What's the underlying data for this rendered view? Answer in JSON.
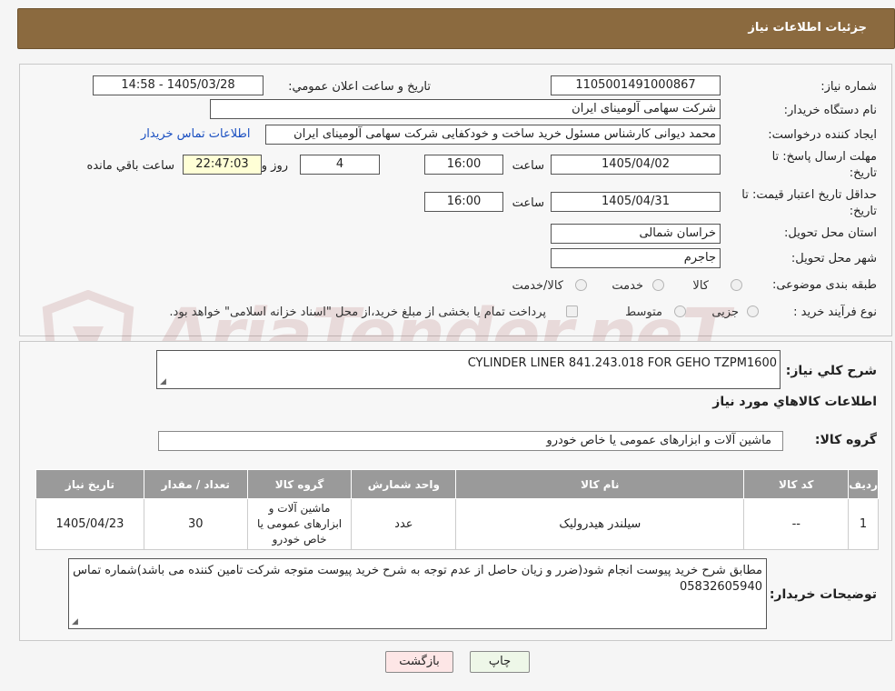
{
  "header": {
    "title": "جزئیات اطلاعات نیاز"
  },
  "form": {
    "need_number_label": "شماره نیاز:",
    "need_number": "1105001491000867",
    "announce_label": "تاریخ و ساعت اعلان عمومي:",
    "announce_value": "1405/03/28 - 14:58",
    "buyer_org_label": "نام دستگاه خریدار:",
    "buyer_org": "شرکت سهامی آلومینای ایران",
    "creator_label": "ایجاد کننده درخواست:",
    "creator": "محمد دیوانی کارشناس مسئول خرید ساخت و خودکفایی شرکت سهامی آلومینای ایران",
    "contact_link": "اطلاعات تماس خریدار",
    "reply_deadline_label": "مهلت ارسال پاسخ: تا",
    "reply_deadline_label2": "تاریخ:",
    "reply_date": "1405/04/02",
    "time_label": "ساعت",
    "reply_time": "16:00",
    "days_value": "4",
    "days_label": "روز و",
    "remaining_time": "22:47:03",
    "remaining_label": "ساعت باقي مانده",
    "price_validity_label": "حداقل تاریخ اعتبار قیمت: تا",
    "price_validity_label2": "تاریخ:",
    "price_date": "1405/04/31",
    "price_time": "16:00",
    "province_label": "استان محل تحویل:",
    "province": "خراسان شمالی",
    "city_label": "شهر محل تحویل:",
    "city": "جاجرم",
    "category_label": "طبقه بندی موضوعی:",
    "category_options": [
      "کالا",
      "خدمت",
      "کالا/خدمت"
    ],
    "process_label": "نوع فرآیند خرید :",
    "process_options": [
      "جزیی",
      "متوسط"
    ],
    "payment_note": "پرداخت تمام یا بخشی از مبلغ خرید،از محل \"اسناد خزانه اسلامی\" خواهد بود."
  },
  "watermark": "AriaTender.neT",
  "description": {
    "label": "شرح کلي نياز:",
    "value": "CYLINDER LINER 841.243.018 FOR GEHO TZPM1600"
  },
  "goods_section_title": "اطلاعات کالاهاي مورد نياز",
  "goods_group": {
    "label": "گروه کالا:",
    "value": "ماشین آلات و ابزارهای عمومی یا خاص خودرو"
  },
  "table": {
    "headers": [
      "رديف",
      "کد کالا",
      "نام کالا",
      "واحد شمارش",
      "گروه کالا",
      "تعداد / مقدار",
      "تاریخ نیاز"
    ],
    "rows": [
      {
        "row": "1",
        "code": "--",
        "name": "سیلندر هیدرولیک",
        "unit": "عدد",
        "group": "ماشین آلات و ابزارهای عمومی یا خاص خودرو",
        "qty": "30",
        "date": "1405/04/23"
      }
    ]
  },
  "buyer_notes": {
    "label": "توضیحات خریدار:",
    "value": "مطابق شرح خرید پیوست انجام شود(ضرر و زیان حاصل از عدم توجه به شرح خرید پیوست متوجه شرکت تامین کننده می باشد)شماره تماس 05832605940"
  },
  "buttons": {
    "print": "چاپ",
    "back": "بازگشت"
  }
}
